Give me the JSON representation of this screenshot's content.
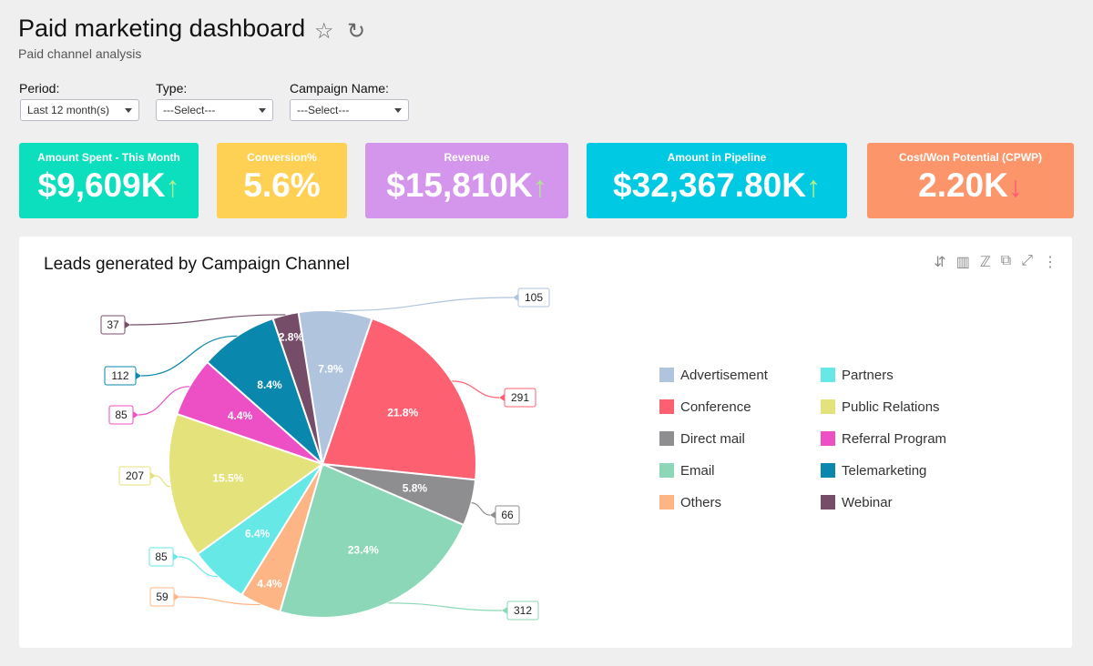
{
  "header": {
    "title": "Paid marketing dashboard",
    "subtitle": "Paid channel analysis",
    "icons": [
      "star-icon",
      "refresh-icon"
    ]
  },
  "filters": [
    {
      "label": "Period:",
      "value": "Last 12 month(s)"
    },
    {
      "label": "Type:",
      "value": "---Select---"
    },
    {
      "label": "Campaign Name:",
      "value": "---Select---"
    }
  ],
  "kpis": [
    {
      "label": "Amount Spent - This Month",
      "value": "$9,609K",
      "trend": "up",
      "color": "#0bdfbd",
      "arrow": "↑",
      "arrow_color": "#b9ec8c"
    },
    {
      "label": "Conversion%",
      "value": "5.6%",
      "trend": "none",
      "color": "#fed155",
      "arrow": "",
      "arrow_color": ""
    },
    {
      "label": "Revenue",
      "value": "$15,810K",
      "trend": "up",
      "color": "#d496ec",
      "arrow": "↑",
      "arrow_color": "#a8ec8c"
    },
    {
      "label": "Amount in Pipeline",
      "value": "$32,367.80K",
      "trend": "up",
      "color": "#00c9e3",
      "arrow": "↑",
      "arrow_color": "#c3ec7c"
    },
    {
      "label": "Cost/Won Potential (CPWP)",
      "value": "2.20K",
      "trend": "down",
      "color": "#fd956a",
      "arrow": "↓",
      "arrow_color": "#fd5a7a"
    }
  ],
  "chart_panel": {
    "title": "Leads generated by Campaign Channel",
    "toolbar_icons": [
      "sort-icon",
      "bar-chart-icon",
      "chart-type-icon",
      "open-external-icon",
      "expand-icon",
      "more-icon"
    ]
  },
  "chart_data": {
    "type": "pie",
    "title": "Leads generated by Campaign Channel",
    "legend_position": "right",
    "slices": [
      {
        "name": "Advertisement",
        "value": 105,
        "percent_label": "7.9%",
        "color": "#b0c4de"
      },
      {
        "name": "Conference",
        "value": 291,
        "percent_label": "21.8%",
        "color": "#fd6071"
      },
      {
        "name": "Direct mail",
        "value": 66,
        "percent_label": "5.8%",
        "color": "#8e8e90"
      },
      {
        "name": "Email",
        "value": 312,
        "percent_label": "23.4%",
        "color": "#8cd7b7"
      },
      {
        "name": "Others",
        "value": 59,
        "percent_label": "4.4%",
        "color": "#fdb586"
      },
      {
        "name": "Partners",
        "value": 85,
        "percent_label": "6.4%",
        "color": "#65e8e6"
      },
      {
        "name": "Public Relations",
        "value": 207,
        "percent_label": "15.5%",
        "color": "#e4e27a"
      },
      {
        "name": "Referral Program",
        "value": 85,
        "percent_label": "4.4%",
        "color": "#ed4fc5"
      },
      {
        "name": "Telemarketing",
        "value": 112,
        "percent_label": "8.4%",
        "color": "#0a87ad"
      },
      {
        "name": "Webinar",
        "value": 37,
        "percent_label": "2.8%",
        "color": "#764d69"
      }
    ]
  }
}
